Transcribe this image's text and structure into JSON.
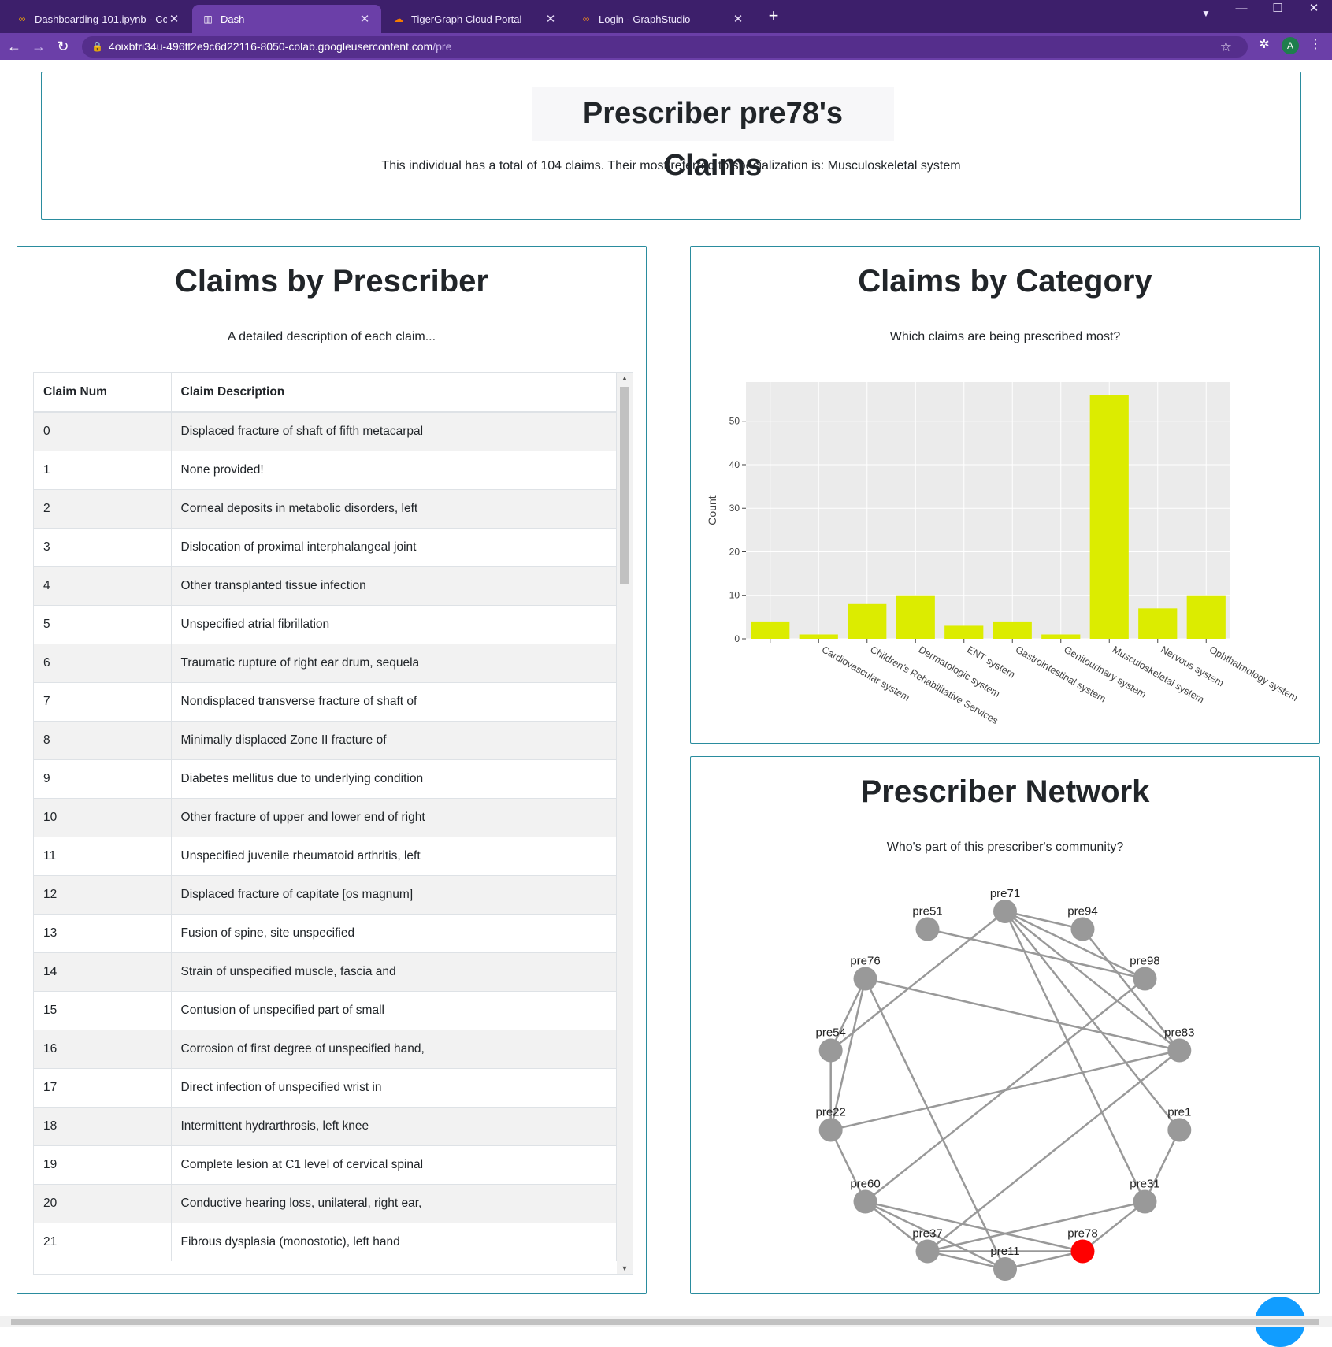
{
  "browser": {
    "tabs": [
      {
        "title": "Dashboarding-101.ipynb - Colab",
        "icon": "colab-icon"
      },
      {
        "title": "Dash",
        "icon": "dash-icon"
      },
      {
        "title": "TigerGraph Cloud Portal",
        "icon": "tigergraph-icon"
      },
      {
        "title": "Login - GraphStudio",
        "icon": "graphstudio-icon"
      }
    ],
    "url_host": "4oixbfri34u-496ff2e9c6d22116-8050-colab.googleusercontent.com",
    "url_path": "/pre",
    "profile_initial": "A"
  },
  "header": {
    "title": "Prescriber pre78's Claims",
    "subtitle": "This individual has a total of 104 claims. Their most referred to specialization is: Musculoskeletal system"
  },
  "claims": {
    "title": "Claims by Prescriber",
    "subtitle": "A detailed description of each claim...",
    "columns": [
      "Claim Num",
      "Claim Description"
    ],
    "rows": [
      [
        "0",
        "Displaced fracture of shaft of fifth metacarpal"
      ],
      [
        "1",
        "None provided!"
      ],
      [
        "2",
        "Corneal deposits in metabolic disorders, left"
      ],
      [
        "3",
        "Dislocation of proximal interphalangeal joint"
      ],
      [
        "4",
        "Other transplanted tissue infection"
      ],
      [
        "5",
        "Unspecified atrial fibrillation"
      ],
      [
        "6",
        "Traumatic rupture of right ear drum, sequela"
      ],
      [
        "7",
        "Nondisplaced transverse fracture of shaft of"
      ],
      [
        "8",
        "Minimally displaced Zone II fracture of"
      ],
      [
        "9",
        "Diabetes mellitus due to underlying condition"
      ],
      [
        "10",
        "Other fracture of upper and lower end of right"
      ],
      [
        "11",
        "Unspecified juvenile rheumatoid arthritis, left"
      ],
      [
        "12",
        "Displaced fracture of capitate [os magnum]"
      ],
      [
        "13",
        "Fusion of spine, site unspecified"
      ],
      [
        "14",
        "Strain of unspecified muscle, fascia and"
      ],
      [
        "15",
        "Contusion of unspecified part of small"
      ],
      [
        "16",
        "Corrosion of first degree of unspecified hand,"
      ],
      [
        "17",
        "Direct infection of unspecified wrist in"
      ],
      [
        "18",
        "Intermittent hydrarthrosis, left knee"
      ],
      [
        "19",
        "Complete lesion at C1 level of cervical spinal"
      ],
      [
        "20",
        "Conductive hearing loss, unilateral, right ear,"
      ],
      [
        "21",
        "Fibrous dysplasia (monostotic), left hand"
      ]
    ]
  },
  "category": {
    "title": "Claims by Category",
    "subtitle": "Which claims are being prescribed most?"
  },
  "chart_data": {
    "type": "bar",
    "categories": [
      "",
      "Cardiovascular system",
      "Children's Rehabilitative Services",
      "Dermatologic system",
      "ENT system",
      "Gastrointestinal system",
      "Genitourinary system",
      "Musculoskeletal system",
      "Nervous system",
      "Ophthalmology system"
    ],
    "values": [
      4,
      1,
      8,
      10,
      3,
      4,
      1,
      56,
      7,
      10
    ],
    "ylabel": "Count",
    "xlabel": "",
    "ylim": [
      0,
      59
    ],
    "yticks": [
      0,
      10,
      20,
      30,
      40,
      50
    ],
    "bar_color": "#dcec00",
    "plot_bg": "#ebebeb",
    "grid": true
  },
  "network": {
    "title": "Prescriber Network",
    "subtitle": "Who's part of this prescriber's community?",
    "highlight": "pre78",
    "node_color": "#999999",
    "highlight_color": "#ff0000",
    "nodes": [
      "pre71",
      "pre94",
      "pre98",
      "pre83",
      "pre1",
      "pre31",
      "pre78",
      "pre11",
      "pre37",
      "pre60",
      "pre22",
      "pre54",
      "pre76",
      "pre51"
    ],
    "edges": [
      [
        "pre71",
        "pre94"
      ],
      [
        "pre71",
        "pre98"
      ],
      [
        "pre71",
        "pre83"
      ],
      [
        "pre71",
        "pre1"
      ],
      [
        "pre71",
        "pre31"
      ],
      [
        "pre71",
        "pre54"
      ],
      [
        "pre94",
        "pre83"
      ],
      [
        "pre51",
        "pre98"
      ],
      [
        "pre76",
        "pre83"
      ],
      [
        "pre76",
        "pre54"
      ],
      [
        "pre76",
        "pre22"
      ],
      [
        "pre76",
        "pre11"
      ],
      [
        "pre98",
        "pre60"
      ],
      [
        "pre83",
        "pre22"
      ],
      [
        "pre83",
        "pre37"
      ],
      [
        "pre1",
        "pre31"
      ],
      [
        "pre31",
        "pre78"
      ],
      [
        "pre31",
        "pre37"
      ],
      [
        "pre78",
        "pre11"
      ],
      [
        "pre78",
        "pre60"
      ],
      [
        "pre78",
        "pre37"
      ],
      [
        "pre60",
        "pre37"
      ],
      [
        "pre60",
        "pre22"
      ],
      [
        "pre54",
        "pre22"
      ],
      [
        "pre37",
        "pre11"
      ],
      [
        "pre11",
        "pre60"
      ]
    ]
  }
}
